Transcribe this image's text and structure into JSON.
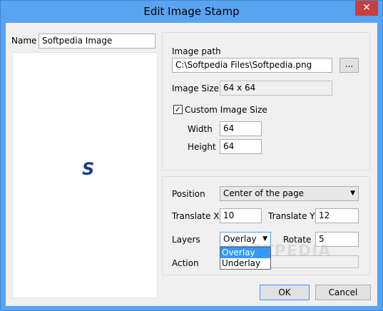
{
  "window": {
    "title": "Edit Image Stamp",
    "close_glyph": "✕"
  },
  "name": {
    "label": "Name",
    "value": "Softpedia Image"
  },
  "preview": {
    "logo_text": "S",
    "logo_color": "#1c3a86"
  },
  "image": {
    "path_label": "Image path",
    "path_value": "C:\\Softpedia Files\\Softpedia.png",
    "browse_label": "...",
    "size_label": "Image Size",
    "size_value": "64 x 64",
    "custom_size_label": "Custom Image Size",
    "custom_size_checked": true,
    "width_label": "Width",
    "width_value": "64",
    "height_label": "Height",
    "height_value": "64"
  },
  "layout": {
    "position_label": "Position",
    "position_value": "Center of the page",
    "translate_x_label": "Translate X",
    "translate_x_value": "10",
    "translate_y_label": "Translate Y",
    "translate_y_value": "12",
    "layers_label": "Layers",
    "layers_value": "Overlay",
    "layers_options": [
      "Overlay",
      "Underlay"
    ],
    "rotate_label": "Rotate",
    "rotate_value": "5",
    "action_label": "Action",
    "action_value": ""
  },
  "footer": {
    "ok_label": "OK",
    "cancel_label": "Cancel"
  },
  "watermark": "SOFTPEDIA",
  "colors": {
    "titlebar": "#5aa3f0",
    "close": "#c73e3e",
    "accent": "#3399ff"
  }
}
